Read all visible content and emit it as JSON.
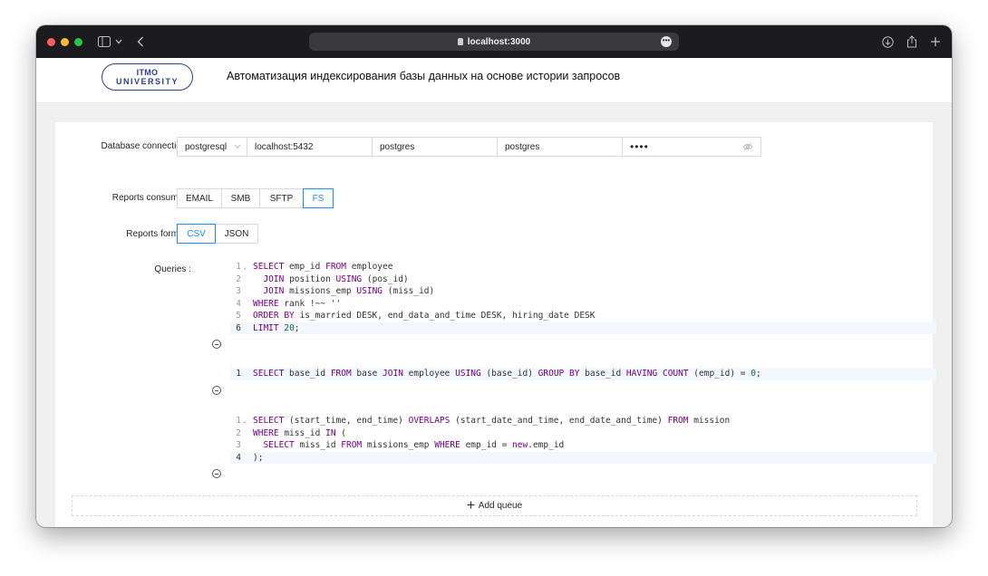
{
  "browser": {
    "address": "localhost:3000"
  },
  "header": {
    "logo_line1": "ITMO",
    "logo_line2": "UNIVERSITY",
    "title": "Автоматизация индексирования базы данных на основе истории запросов"
  },
  "connection": {
    "label": "Database connection",
    "driver": "postgresql",
    "host": "localhost:5432",
    "user": "postgres",
    "database": "postgres",
    "password_masked": "••••"
  },
  "consumer": {
    "label": "Reports consumer",
    "options": [
      "EMAIL",
      "SMB",
      "SFTP",
      "FS"
    ],
    "selected": "FS"
  },
  "format": {
    "label": "Reports format",
    "options": [
      "CSV",
      "JSON"
    ],
    "selected": "CSV"
  },
  "queries": {
    "label": "Queries",
    "items": [
      {
        "active_line": 6,
        "lines": [
          "SELECT emp_id FROM employee",
          "  JOIN position USING (pos_id)",
          "  JOIN missions_emp USING (miss_id)",
          "WHERE rank !~~ ''",
          "ORDER BY is_married DESK, end_data_and_time DESK, hiring_date DESK",
          "LIMIT 20;"
        ]
      },
      {
        "active_line": 1,
        "lines": [
          "SELECT base_id FROM base JOIN employee USING (base_id) GROUP BY base_id HAVING COUNT (emp_id) = 0;"
        ]
      },
      {
        "active_line": 4,
        "lines": [
          "SELECT (start_time, end_time) OVERLAPS (start_date_and_time, end_date_and_time) FROM mission",
          "WHERE miss_id IN (",
          "  SELECT miss_id FROM missions_emp WHERE emp_id = new.emp_id",
          ");"
        ]
      }
    ],
    "add_label": "Add queue"
  },
  "colors": {
    "accent": "#1890ff",
    "keyword": "#770088",
    "number": "#116644",
    "logo": "#2c3f8c"
  }
}
